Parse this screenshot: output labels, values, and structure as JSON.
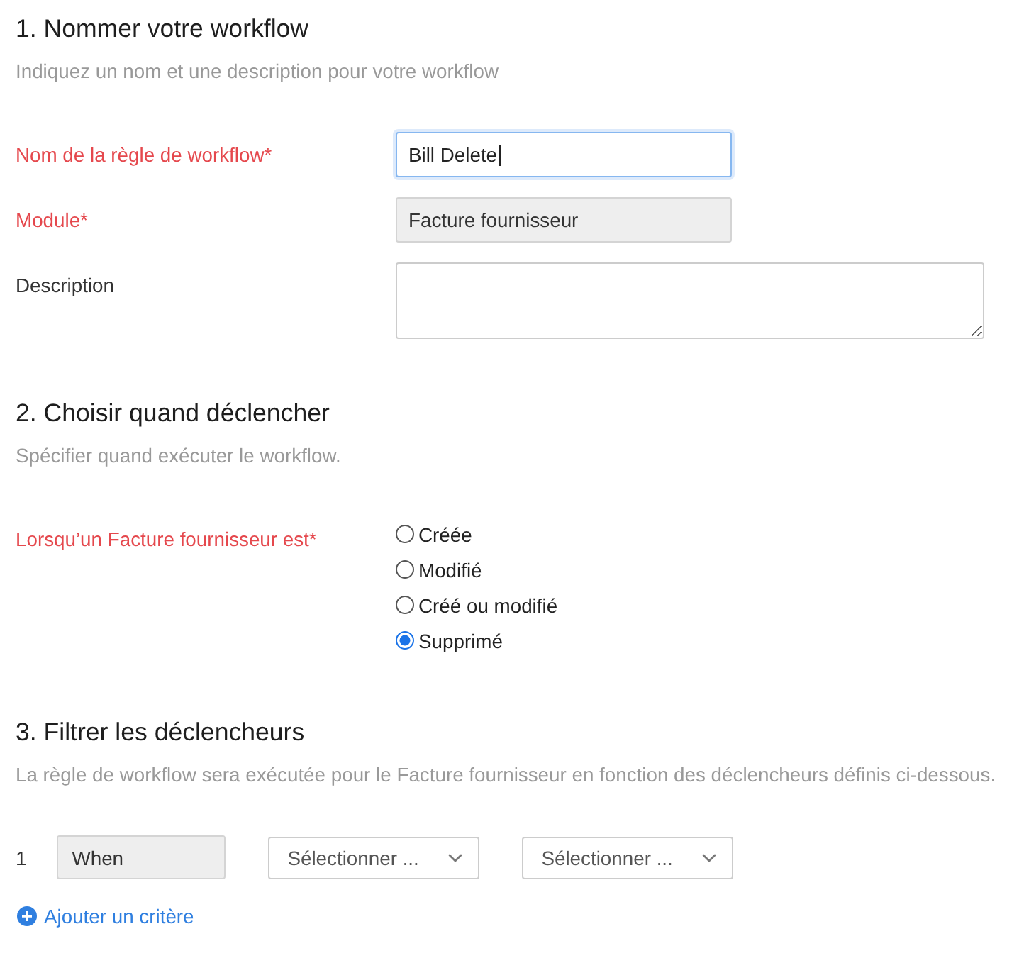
{
  "sections": [
    {
      "kind": "form",
      "title": "1. Nommer votre workflow",
      "description": "Indiquez un nom et une description pour votre workflow",
      "fields": [
        {
          "kind": "text",
          "label": "Nom de la règle de workflow*",
          "required": true,
          "value": "Bill Delete",
          "focused": true,
          "disabled": false
        },
        {
          "kind": "text",
          "label": "Module*",
          "required": true,
          "value": "Facture fournisseur",
          "focused": false,
          "disabled": true
        },
        {
          "kind": "textarea",
          "label": "Description",
          "required": false
        }
      ]
    },
    {
      "kind": "form",
      "title": "2. Choisir quand déclencher",
      "description": "Spécifier quand exécuter le workflow.",
      "fields": [
        {
          "kind": "radio",
          "label": "Lorsqu’un Facture fournisseur est*",
          "required": true,
          "options": [
            {
              "label": "Créée",
              "selected": false
            },
            {
              "label": "Modifié",
              "selected": false
            },
            {
              "label": "Créé ou modifié",
              "selected": false
            },
            {
              "label": "Supprimé",
              "selected": true
            }
          ]
        }
      ]
    },
    {
      "kind": "criteria",
      "title": "3. Filtrer les déclencheurs",
      "description": "La règle de workflow sera exécutée pour le Facture fournisseur en fonction des déclencheurs définis ci-dessous.",
      "criteria": [
        {
          "number": "1",
          "field": "When",
          "selects": [
            "Sélectionner ...",
            "Sélectionner ..."
          ]
        }
      ],
      "add_link": "Ajouter un critère"
    }
  ]
}
